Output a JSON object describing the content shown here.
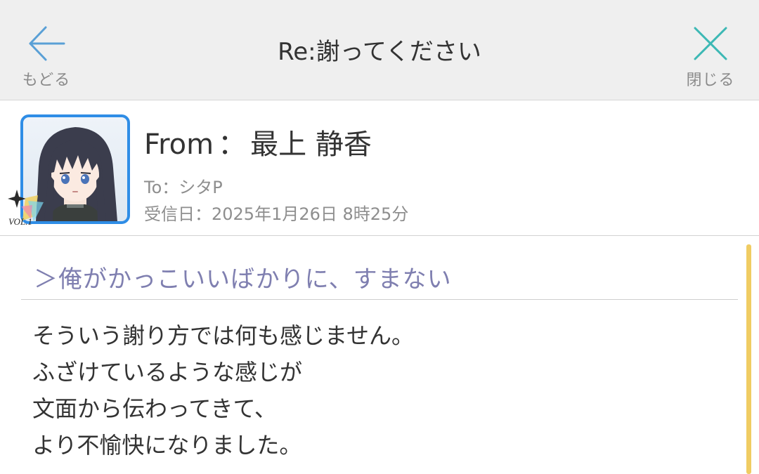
{
  "header": {
    "back_label": "もどる",
    "title": "Re:謝ってください",
    "close_label": "閉じる",
    "back_icon": "arrow-left-icon",
    "close_icon": "close-x-icon"
  },
  "sender": {
    "from_prefix": "From",
    "from_separator": "：",
    "from_name": "最上 静香",
    "to_line": "To：シタP",
    "date_line": "受信日：2025年1月26日 8時25分",
    "badge_text": "VOL.1"
  },
  "message": {
    "quote": "＞俺がかっこいいばかりに、すまない",
    "lines": [
      "そういう謝り方では何も感じません。",
      "ふざけているような感じが",
      "文面から伝わってきて、",
      "より不愉快になりました。"
    ]
  },
  "colors": {
    "header_bg": "#efefef",
    "back_icon": "#5aa0d6",
    "close_icon": "#3cb8b4",
    "avatar_border": "#2f8de6",
    "quote_text": "#7f7fb0",
    "scrollbar": "#f0cc63"
  }
}
